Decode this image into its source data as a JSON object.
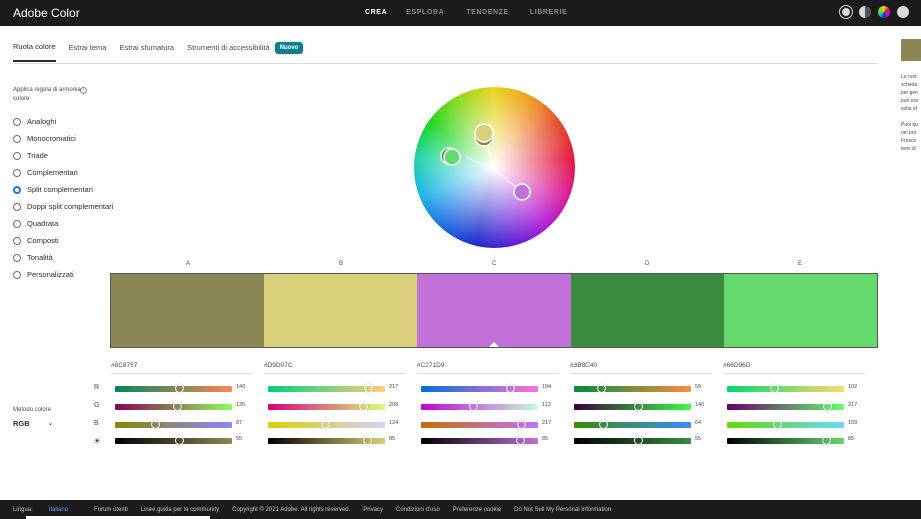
{
  "app": {
    "title": "Adobe Color"
  },
  "topnav": [
    {
      "label": "CREA",
      "active": true
    },
    {
      "label": "ESPLORA",
      "active": false
    },
    {
      "label": "TENDENZE",
      "active": false
    },
    {
      "label": "LIBRERIE",
      "active": false
    }
  ],
  "tabs": [
    {
      "label": "Ruota colore",
      "active": true
    },
    {
      "label": "Estrai tema",
      "active": false
    },
    {
      "label": "Estrai sfumatura",
      "active": false
    },
    {
      "label": "Strumenti di accessibilità",
      "active": false
    }
  ],
  "new_badge": "Nuovo",
  "sidebar": {
    "harmony_heading": "Applica regola di armonia colore",
    "rules": [
      {
        "label": "Analoghi",
        "selected": false
      },
      {
        "label": "Monocromatici",
        "selected": false
      },
      {
        "label": "Triade",
        "selected": false
      },
      {
        "label": "Complementari",
        "selected": false
      },
      {
        "label": "Split complementari",
        "selected": true
      },
      {
        "label": "Doppi split complementari",
        "selected": false
      },
      {
        "label": "Quadrata",
        "selected": false
      },
      {
        "label": "Composti",
        "selected": false
      },
      {
        "label": "Tonalità",
        "selected": false
      },
      {
        "label": "Personalizzati",
        "selected": false
      }
    ],
    "color_method_label": "Metodo colore",
    "color_method_value": "RGB"
  },
  "swatches": [
    {
      "letter": "A",
      "hex": "#8C8757",
      "color": "#8c8757",
      "r": 140,
      "g": 135,
      "b": 87,
      "bright": 55
    },
    {
      "letter": "B",
      "hex": "#D9D07C",
      "color": "#d9d07c",
      "r": 217,
      "g": 208,
      "b": 124,
      "bright": 85
    },
    {
      "letter": "C",
      "hex": "#C271D9",
      "color": "#c271d9",
      "r": 194,
      "g": 113,
      "b": 217,
      "bright": 85
    },
    {
      "letter": "D",
      "hex": "#3B8C40",
      "color": "#3b8c40",
      "r": 59,
      "g": 140,
      "b": 64,
      "bright": 55
    },
    {
      "letter": "E",
      "hex": "#66D96D",
      "color": "#66d96d",
      "r": 102,
      "g": 217,
      "b": 109,
      "bright": 85
    }
  ],
  "selected_swatch": "C",
  "channel_labels": {
    "r": "R",
    "g": "G",
    "b": "B",
    "bright": "☀"
  },
  "right_panel": {
    "lines": [
      "La ruot",
      "scheda",
      "per gen",
      "può ess",
      "volta ef",
      "",
      "Puoi qu",
      "nei pro",
      "Fresco",
      "temi di"
    ]
  },
  "footer": {
    "language_label": "Lingua:",
    "language_value": "Italiano",
    "links": [
      "Forum utenti",
      "Linee guida per la community"
    ],
    "copyright": "Copyright © 2021 Adobe. All rights reserved.",
    "links2": [
      "Privacy",
      "Condizioni d'uso",
      "Preferenze cookie",
      "Do Not Sell My Personal Information"
    ]
  }
}
